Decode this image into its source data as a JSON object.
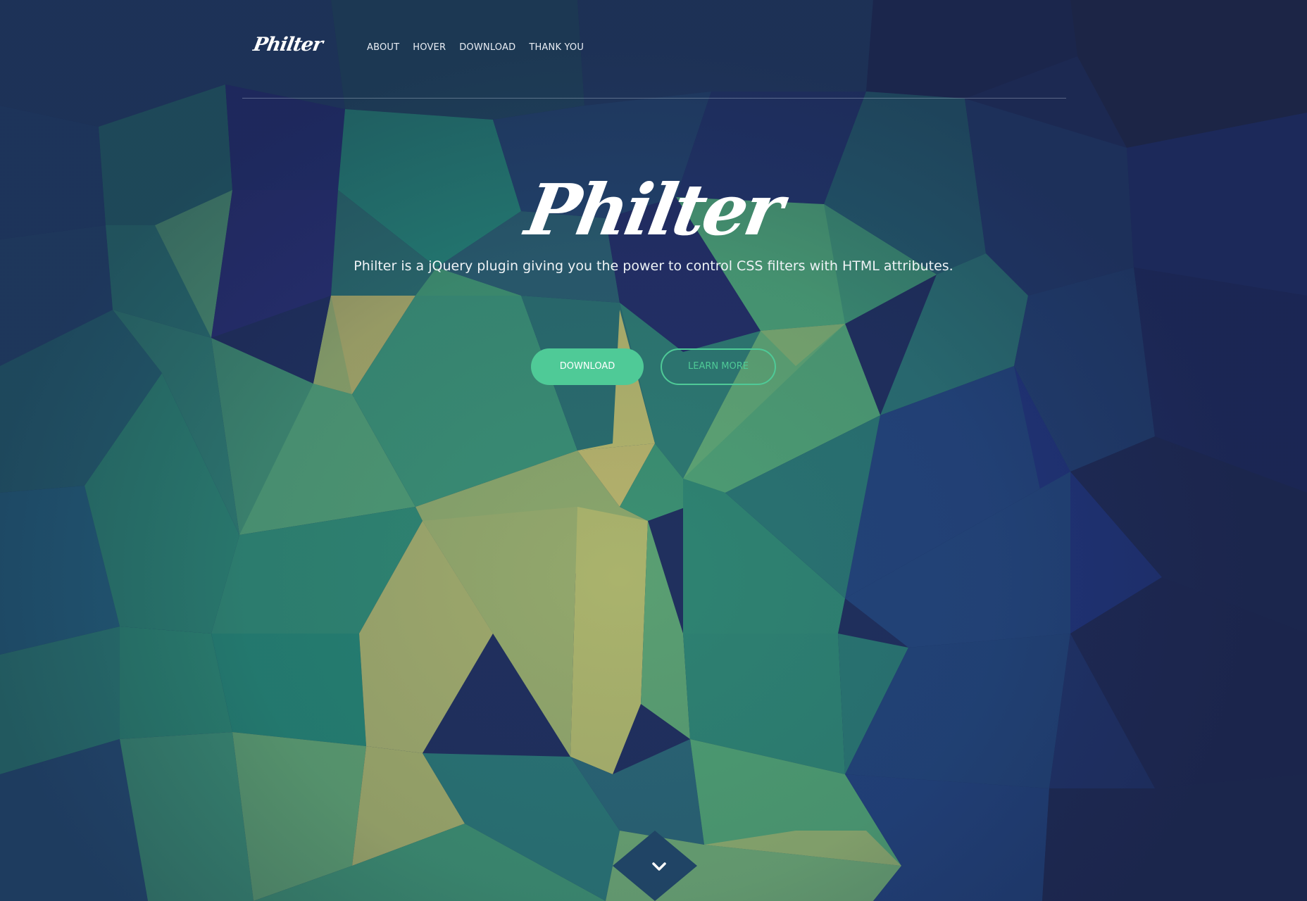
{
  "header": {
    "logo": "Philter",
    "nav": [
      {
        "label": "ABOUT"
      },
      {
        "label": "HOVER"
      },
      {
        "label": "DOWNLOAD"
      },
      {
        "label": "THANK YOU"
      }
    ]
  },
  "hero": {
    "title": "Philter",
    "subtitle": "Philter is a jQuery plugin giving you the power to control CSS filters with HTML attributes.",
    "download_label": "DOWNLOAD",
    "learn_more_label": "LEARN MORE"
  },
  "scroll": {
    "icon": "chevron-down-icon"
  },
  "colors": {
    "accent": "#4fca97",
    "navy": "#1f2b5e",
    "teal": "#227a72",
    "green": "#4aa070",
    "yellow": "#b2b46e"
  }
}
